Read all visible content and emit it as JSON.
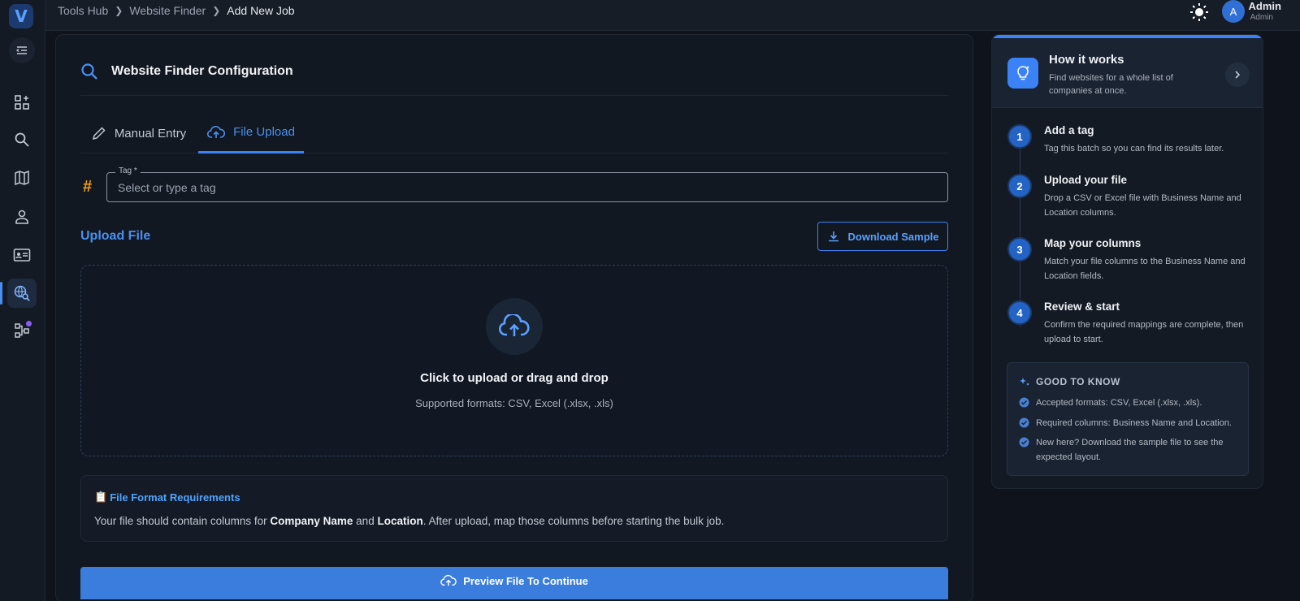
{
  "sidebar": {
    "logo_letter": "V"
  },
  "breadcrumb": {
    "items": [
      "Tools Hub",
      "Website Finder",
      "Add New Job"
    ]
  },
  "user": {
    "initial": "A",
    "name": "Admin",
    "role": "Admin"
  },
  "config": {
    "title": "Website Finder Configuration",
    "tabs": [
      {
        "label": "Manual Entry",
        "active": false
      },
      {
        "label": "File Upload",
        "active": true
      }
    ],
    "tag": {
      "label": "Tag *",
      "placeholder": "Select or type a tag",
      "value": ""
    },
    "upload_title": "Upload File",
    "download_sample_label": "Download Sample",
    "dropzone": {
      "title": "Click to upload or drag and drop",
      "subtitle": "Supported formats: CSV, Excel (.xlsx, .xls)"
    },
    "requirements": {
      "icon": "📋",
      "title": "File Format Requirements",
      "text_before": "Your file should contain columns for ",
      "bold1": "Company Name",
      "text_mid": " and ",
      "bold2": "Location",
      "text_after": ". After upload, map those columns before starting the bulk job."
    },
    "preview_button_label": "Preview File To Continue"
  },
  "how_it_works": {
    "title": "How it works",
    "subtitle": "Find websites for a whole list of companies at once.",
    "steps": [
      {
        "num": "1",
        "title": "Add a tag",
        "desc": "Tag this batch so you can find its results later."
      },
      {
        "num": "2",
        "title": "Upload your file",
        "desc": "Drop a CSV or Excel file with Business Name and Location columns."
      },
      {
        "num": "3",
        "title": "Map your columns",
        "desc": "Match your file columns to the Business Name and Location fields."
      },
      {
        "num": "4",
        "title": "Review & start",
        "desc": "Confirm the required mappings are complete, then upload to start."
      }
    ],
    "good_to_know": {
      "title": "GOOD TO KNOW",
      "items": [
        "Accepted formats: CSV, Excel (.xlsx, .xls).",
        "Required columns: Business Name and Location.",
        "New here? Download the sample file to see the expected layout."
      ]
    }
  },
  "colors": {
    "accent": "#3b82f6",
    "background": "#0f141c",
    "tag_hash": "#f59e0b"
  }
}
